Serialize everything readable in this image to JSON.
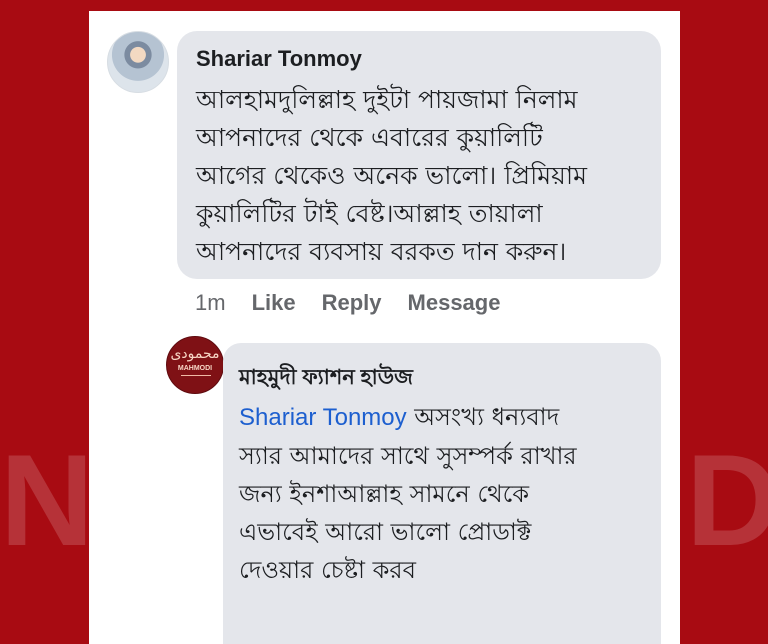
{
  "background": {
    "color": "#a80b12",
    "watermark_left": "N",
    "watermark_right": "Di"
  },
  "comment": {
    "author": "Shariar Tonmoy",
    "text": "আলহামদুলিল্লাহ দুইটা পায়জামা নিলাম\nআপনাদের থেকে এবারের কুয়ালিটি\nআগের থেকেও অনেক ভালো। প্রিমিয়াম\nকুয়ালিটির টাই বেষ্ট।আল্লাহ তায়ালা\nআপনাদের ব্যবসায় বরকত দান করুন।",
    "actions": {
      "time": "1m",
      "like": "Like",
      "reply": "Reply",
      "message": "Message"
    },
    "avatar_icon": "user-avatar-icon"
  },
  "reply": {
    "author": "মাহমুদী ফ্যাশন হাউজ",
    "mention": "Shariar Tonmoy",
    "text": " অসংখ্য ধন্যবাদ\nস্যার আমাদের সাথে সুসম্পর্ক রাখার\nজন্য ইনশাআল্লাহ সামনে থেকে\nএভাবেই আরো ভালো প্রোডাক্ট\nদেওয়ার চেষ্টা করব",
    "avatar_logo": {
      "script": "محمودی",
      "name": "MAHMODI"
    },
    "avatar_icon": "page-logo-icon"
  }
}
